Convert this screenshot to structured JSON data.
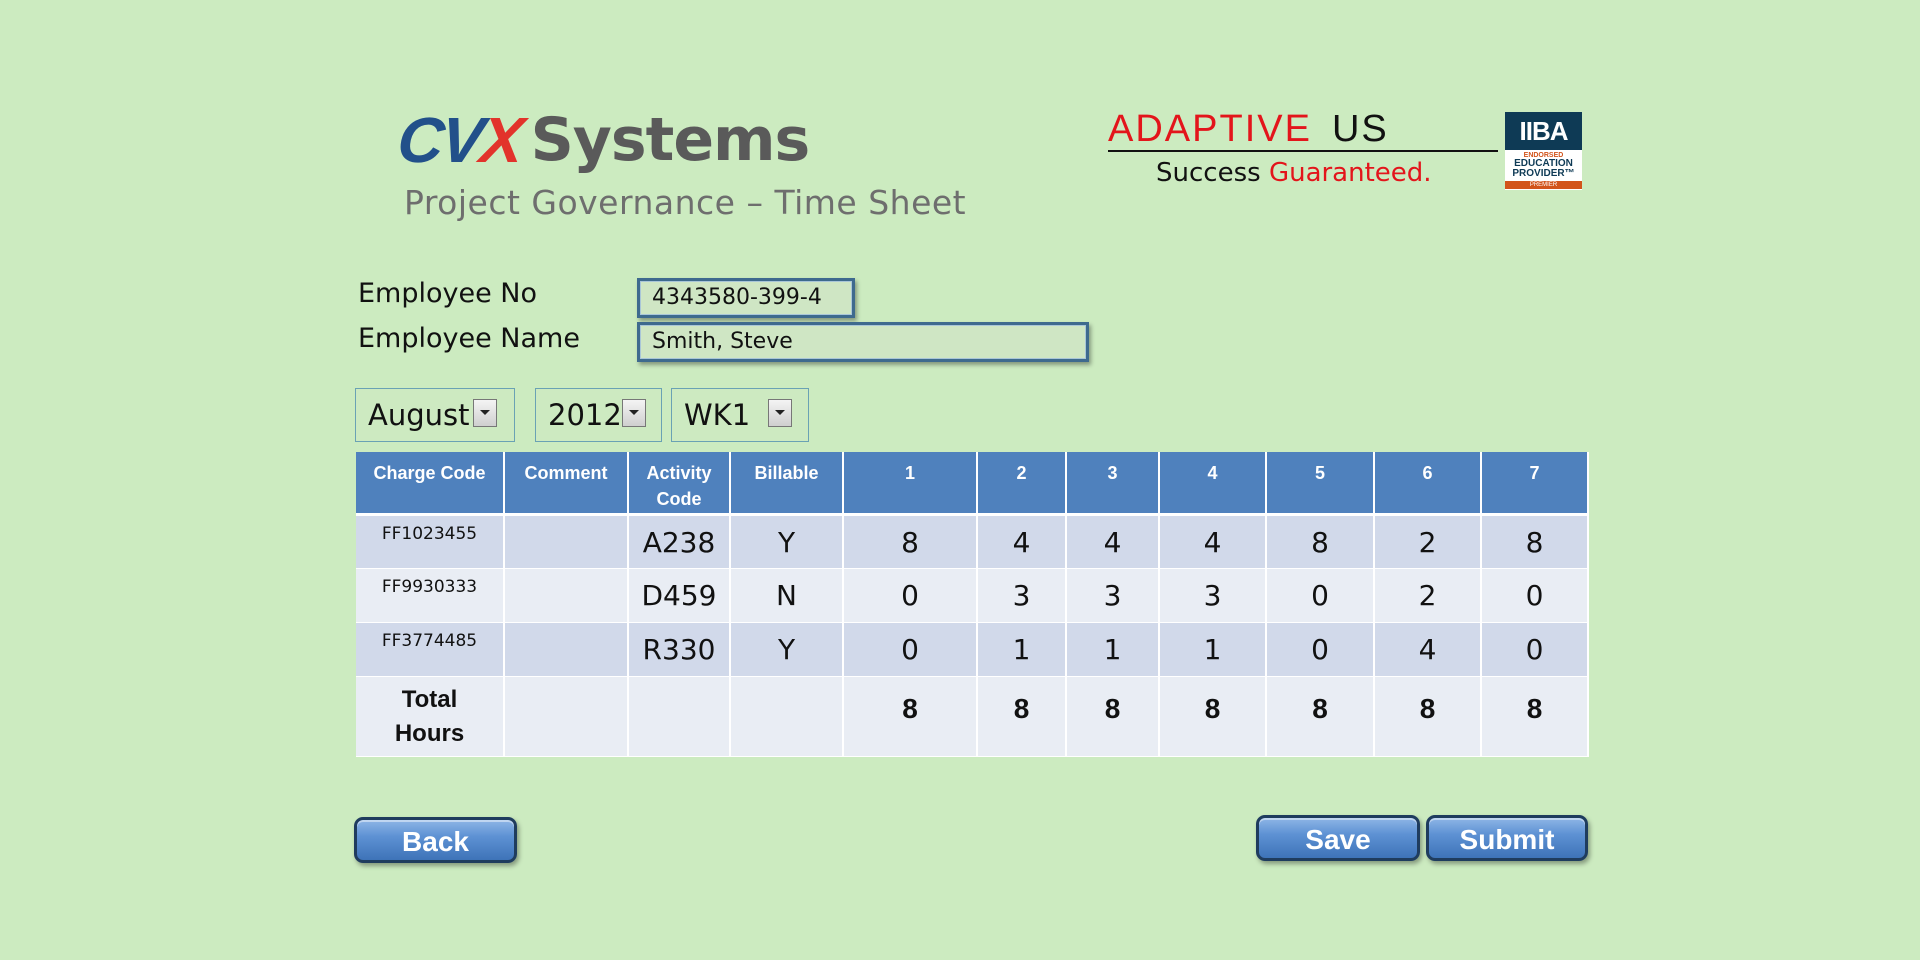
{
  "header": {
    "brand_cvx_main": "CV",
    "brand_cvx_x": "X",
    "brand_systems": "Systems",
    "subtitle": "Project Governance – Time Sheet",
    "partner_wordmark_red": "ADAPTIVE",
    "partner_wordmark_black": "US",
    "partner_tagline_start": "Success ",
    "partner_tagline_accent": "Guaranteed.",
    "iiba_badge": {
      "title": "IIBA",
      "line1": "ENDORSED",
      "line2": "EDUCATION",
      "line3": "PROVIDER™",
      "line4": "PREMIER"
    }
  },
  "employee": {
    "number_label": "Employee No",
    "number_value": "4343580-399-4",
    "name_label": "Employee Name",
    "name_value": "Smith, Steve"
  },
  "period": {
    "month": "August",
    "year": "2012",
    "week": "WK1"
  },
  "table": {
    "headers": [
      "Charge Code",
      "Comment",
      "Activity Code",
      "Billable",
      "1",
      "2",
      "3",
      "4",
      "5",
      "6",
      "7"
    ],
    "rows": [
      {
        "charge_code": "FF1023455",
        "comment": "",
        "activity_code": "A238",
        "billable": "Y",
        "hours": [
          "8",
          "4",
          "4",
          "4",
          "8",
          "2",
          "8"
        ]
      },
      {
        "charge_code": "FF9930333",
        "comment": "",
        "activity_code": "D459",
        "billable": "N",
        "hours": [
          "0",
          "3",
          "3",
          "3",
          "0",
          "2",
          "0"
        ]
      },
      {
        "charge_code": "FF3774485",
        "comment": "",
        "activity_code": "R330",
        "billable": "Y",
        "hours": [
          "0",
          "1",
          "1",
          "1",
          "0",
          "4",
          "0"
        ]
      }
    ],
    "total_label_line1": "Total",
    "total_label_line2": "Hours",
    "totals": [
      "8",
      "8",
      "8",
      "8",
      "8",
      "8",
      "8"
    ]
  },
  "buttons": {
    "back": "Back",
    "save": "Save",
    "submit": "Submit"
  },
  "colors": {
    "background": "#ccebc0",
    "table_header": "#4f81bd",
    "button": "#4f81bd",
    "brand_blue": "#22508a",
    "brand_red": "#e3151b"
  }
}
